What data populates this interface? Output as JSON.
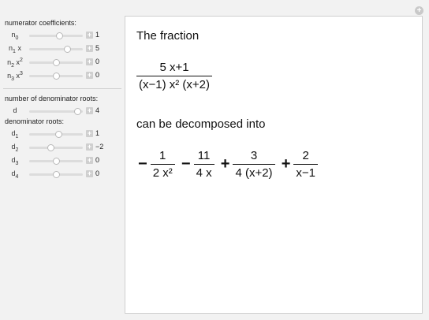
{
  "window": {
    "corner_button_symbol": "+"
  },
  "panel": {
    "numerator_heading": "numerator coefficients:",
    "numerator": [
      {
        "label": "n",
        "sub": "0",
        "var": "",
        "pow": "",
        "value": "1",
        "fraction": 0.56
      },
      {
        "label": "n",
        "sub": "1",
        "var": "x",
        "pow": "",
        "value": "5",
        "fraction": 0.7
      },
      {
        "label": "n",
        "sub": "2",
        "var": "x",
        "pow": "2",
        "value": "0",
        "fraction": 0.5
      },
      {
        "label": "n",
        "sub": "3",
        "var": "x",
        "pow": "3",
        "value": "0",
        "fraction": 0.5
      }
    ],
    "number_heading": "number of denominator roots:",
    "d_control": {
      "label": "d",
      "value": "4",
      "fraction": 0.9
    },
    "roots_heading": "denominator roots:",
    "roots": [
      {
        "label": "d",
        "sub": "1",
        "value": "1",
        "fraction": 0.55
      },
      {
        "label": "d",
        "sub": "2",
        "value": "−2",
        "fraction": 0.4
      },
      {
        "label": "d",
        "sub": "3",
        "value": "0",
        "fraction": 0.5
      },
      {
        "label": "d",
        "sub": "4",
        "value": "0",
        "fraction": 0.5
      }
    ],
    "plus_symbol": "+"
  },
  "content": {
    "intro": "The fraction",
    "fraction": {
      "numerator": "5 x+1",
      "denominator": "(x−1) x² (x+2)"
    },
    "middle": "can be decomposed into",
    "decomposition": [
      {
        "sign": "−",
        "num": "1",
        "den": "2 x²"
      },
      {
        "sign": "−",
        "num": "11",
        "den": "4 x"
      },
      {
        "sign": "+",
        "num": "3",
        "den": "4 (x+2)"
      },
      {
        "sign": "+",
        "num": "2",
        "den": "x−1"
      }
    ]
  }
}
